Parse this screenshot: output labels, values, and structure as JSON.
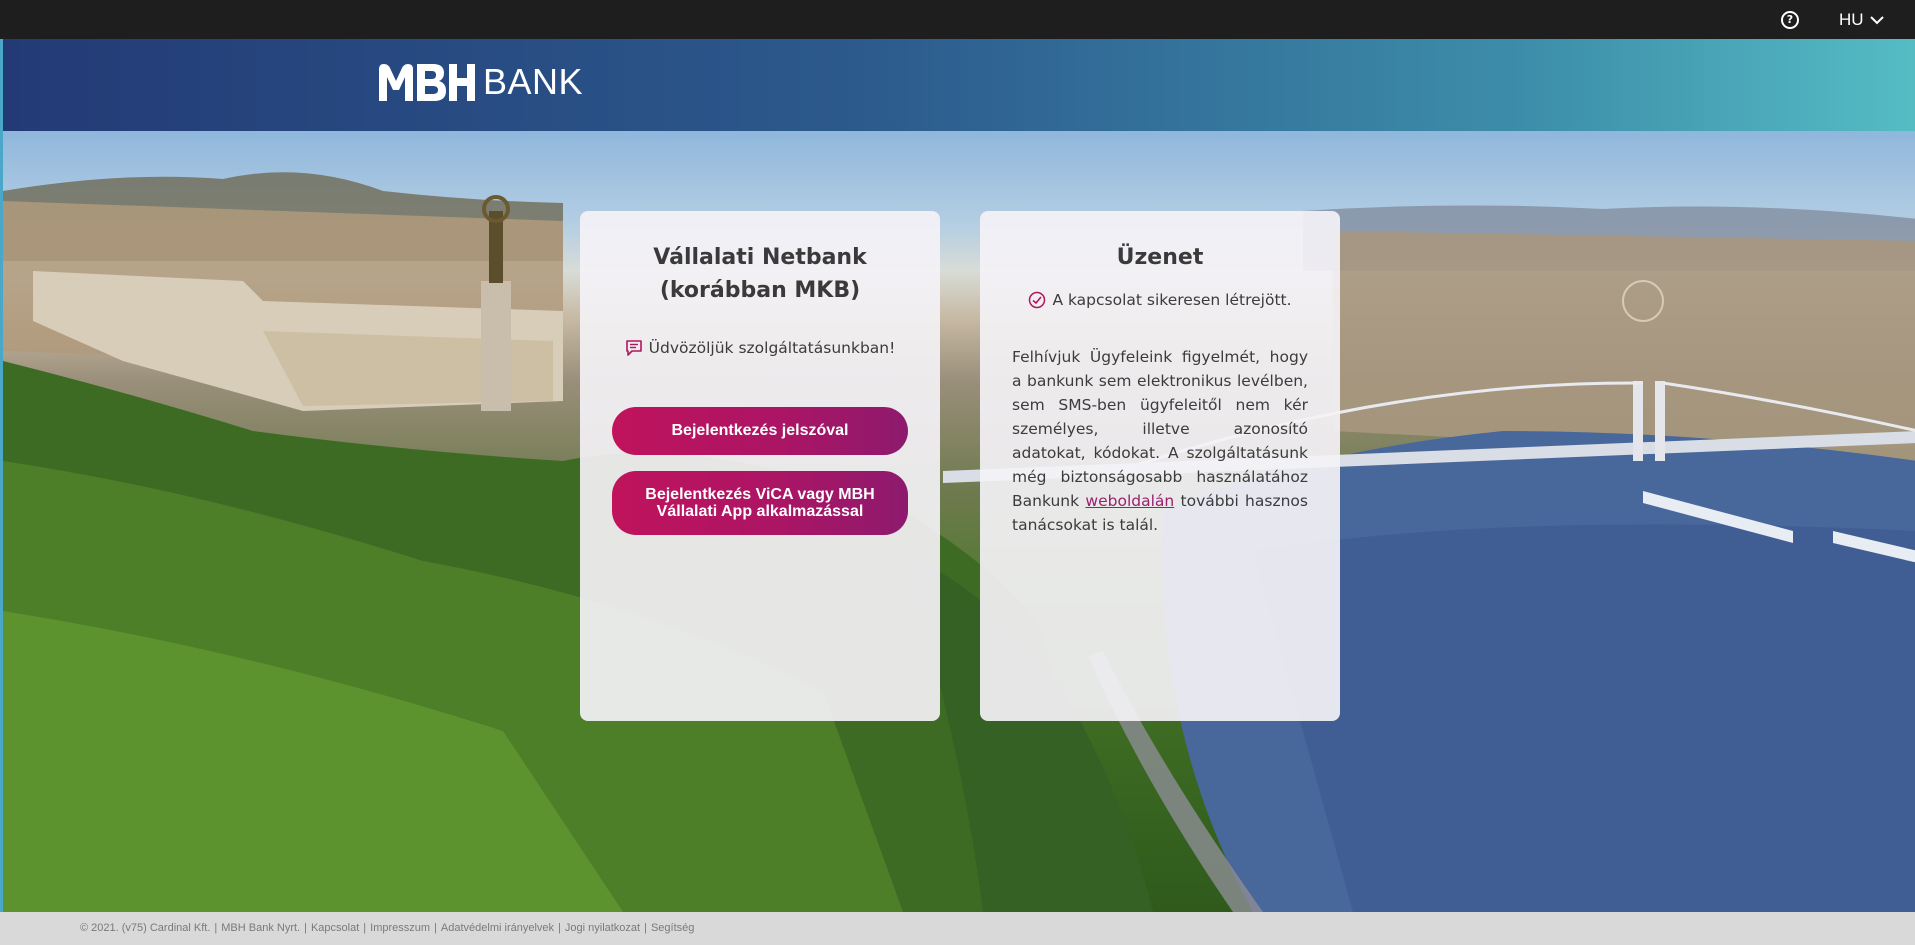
{
  "topbar": {
    "help_icon": "question-circle-icon",
    "language": "HU"
  },
  "header": {
    "logo_text": "BANK",
    "logo_mark": "MBH"
  },
  "left_panel": {
    "title_line1": "Vállalati Netbank",
    "title_line2": "(korábban MKB)",
    "welcome": "Üdvözöljük szolgáltatásunkban!",
    "btn_password": "Bejelentkezés jelszóval",
    "btn_app_line1": "Bejelentkezés ViCA vagy MBH",
    "btn_app_line2": "Vállalati App alkalmazással"
  },
  "right_panel": {
    "title": "Üzenet",
    "status": "A kapcsolat sikeresen létrejött.",
    "message_before": "Felhívjuk Ügyfeleink figyelmét, hogy a bankunk sem elektronikus levélben, sem SMS-ben ügyfeleitől nem kér személyes, illetve azonosító adatokat, kódokat. A szolgáltatásunk még biztonságosabb használatához Bankunk",
    "message_link": "weboldalán",
    "message_after": "további hasznos tanácsokat is talál."
  },
  "footer": {
    "copyright": "© 2021. (v75) Cardinal Kft.",
    "links": [
      "MBH Bank Nyrt.",
      "Kapcsolat",
      "Impresszum",
      "Adatvédelmi irányelvek",
      "Jogi nyilatkozat",
      "Segítség"
    ]
  },
  "colors": {
    "accent": "#c0135c",
    "accent_end": "#8d1a6e",
    "link": "#9b2070"
  }
}
